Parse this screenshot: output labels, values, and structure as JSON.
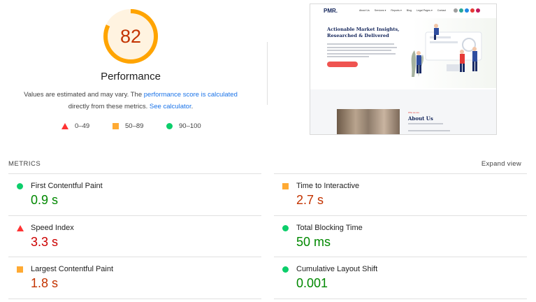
{
  "score": {
    "value": "82",
    "fraction": 0.82,
    "title": "Performance",
    "description_before": "Values are estimated and may vary. The ",
    "link_score": "performance score is calculated",
    "description_middle": "directly from these metrics. ",
    "link_calculator": "See calculator",
    "description_end": ".",
    "colors": {
      "average": "#ffa400",
      "average_bg": "#fff3e0",
      "average_text": "#c33300"
    }
  },
  "legend": [
    {
      "shape": "triangle",
      "label": "0–49",
      "color": "#ff3333"
    },
    {
      "shape": "square",
      "label": "50–89",
      "color": "#ffaa33"
    },
    {
      "shape": "circle",
      "label": "90–100",
      "color": "#0cce6b"
    }
  ],
  "thumbnail": {
    "logo_text": "PMR.",
    "nav_items": [
      "About Us",
      "Services ▾",
      "Reports ▾",
      "Blog",
      "Legal Pages ▾",
      "Contact"
    ],
    "headline": "Actionable Market Insights, Researched & Delivered",
    "about_kicker": "Who we are",
    "about_title": "About Us"
  },
  "metrics": {
    "heading": "METRICS",
    "expand_label": "Expand view",
    "items": [
      {
        "name": "First Contentful Paint",
        "value": "0.9 s",
        "rating": "good"
      },
      {
        "name": "Time to Interactive",
        "value": "2.7 s",
        "rating": "average"
      },
      {
        "name": "Speed Index",
        "value": "3.3 s",
        "rating": "fail"
      },
      {
        "name": "Total Blocking Time",
        "value": "50 ms",
        "rating": "good"
      },
      {
        "name": "Largest Contentful Paint",
        "value": "1.8 s",
        "rating": "average"
      },
      {
        "name": "Cumulative Layout Shift",
        "value": "0.001",
        "rating": "good"
      }
    ]
  }
}
